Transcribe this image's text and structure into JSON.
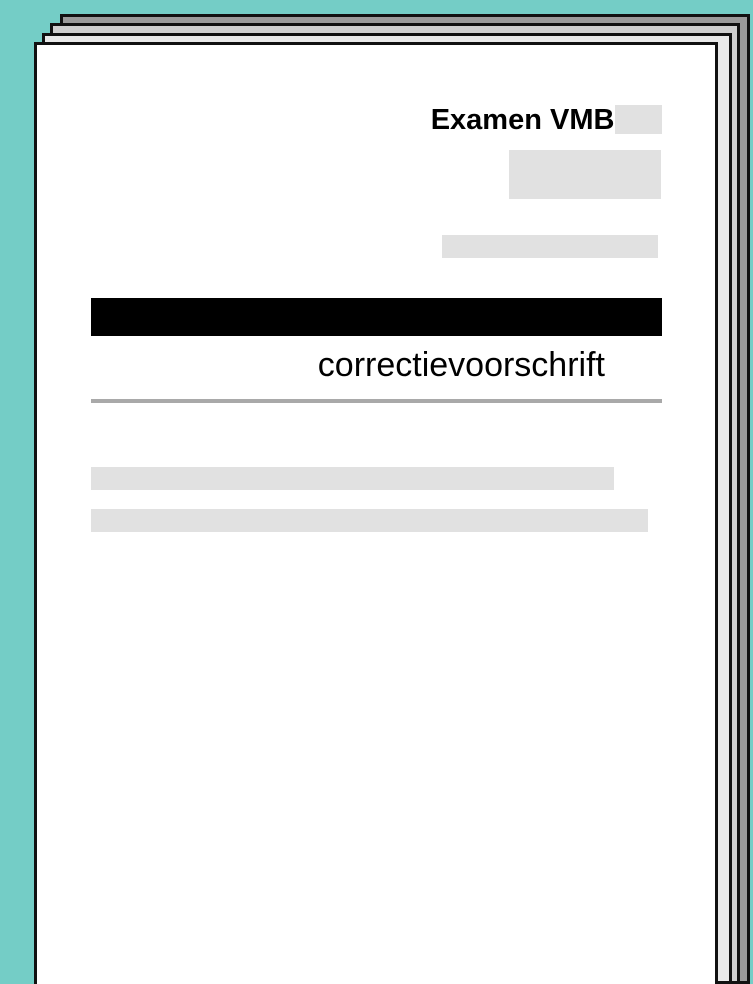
{
  "document": {
    "exam_title": "Examen VMBO",
    "doc_type": "correctievoorschrift"
  },
  "colors": {
    "background": "#74cdc6",
    "page": "#ffffff",
    "placeholder": "#e1e1e1",
    "subject_bar": "#000000",
    "rule": "#a9a9a9"
  }
}
